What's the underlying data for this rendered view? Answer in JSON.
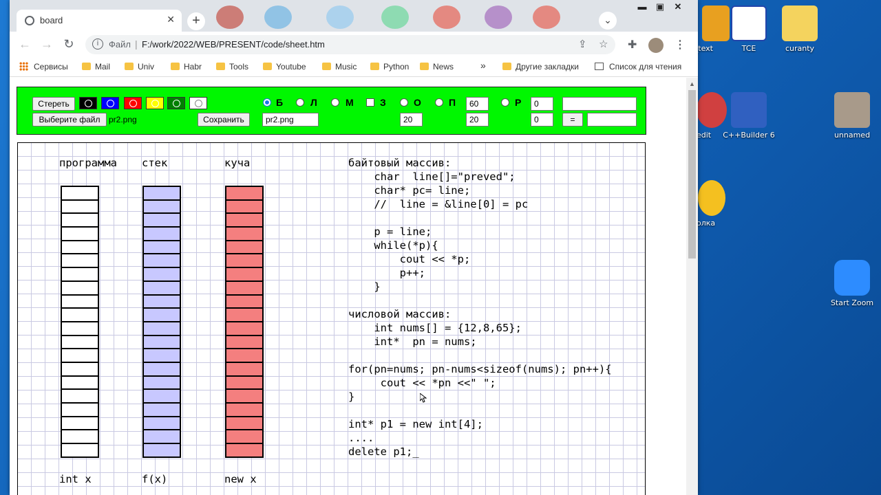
{
  "tab": {
    "title": "board"
  },
  "address": {
    "protocol_label": "Файл",
    "url": "F:/work/2022/WEB/PRESENT/code/sheet.htm"
  },
  "bookmarks": {
    "apps": "Сервисы",
    "items": [
      "Mail",
      "Univ",
      "Habr",
      "Tools",
      "Youtube",
      "Music",
      "Python",
      "News"
    ],
    "more": "»",
    "other": "Другие закладки",
    "reading_list": "Список для чтения"
  },
  "panel": {
    "erase": "Стереть",
    "choose_file": "Выберите файл",
    "file_name": "pr2.png",
    "save": "Сохранить",
    "save_name": "pr2.png",
    "colors": [
      "#000000",
      "#0000ff",
      "#ff0000",
      "#ffff00",
      "#008000",
      "#ffffff"
    ],
    "options": [
      "Б",
      "Л",
      "М",
      "З",
      "О",
      "П",
      "Р"
    ],
    "inputs": {
      "p_top": "60",
      "o_bottom": "20",
      "p_bottom": "20",
      "r_top": "0",
      "r_bottom": "0",
      "eq": "="
    }
  },
  "board": {
    "headers": [
      "программа",
      "стек",
      "куча"
    ],
    "footers": [
      "int x",
      "f(x)",
      "new x"
    ],
    "column_colors": [
      "#ffffff",
      "#c8c8ff",
      "#f47f7f"
    ],
    "code": [
      "байтовый массив:",
      "    char  line[]=\"preved\";",
      "    char* pc= line;",
      "    //  line = &line[0] = pc",
      "",
      "    p = line;",
      "    while(*p){",
      "        cout << *p;",
      "        p++;",
      "    }",
      "",
      "числовой массив:",
      "    int nums[] = {12,8,65};",
      "    int*  pn = nums;",
      "",
      "for(pn=nums; pn-nums<sizeof(nums); pn++){",
      "     cout << *pn <<\" \";",
      "}",
      "",
      "int* p1 = new int[4];",
      "....",
      "delete p1;_"
    ]
  },
  "desktop": {
    "icons": [
      "e_text",
      "TCE",
      "curanty",
      "edit",
      "C++Builder 6",
      "unnamed",
      "олка",
      "Start Zoom"
    ]
  }
}
